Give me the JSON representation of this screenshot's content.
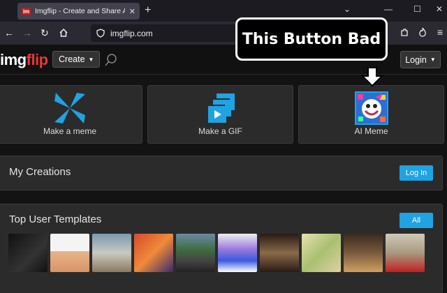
{
  "browser": {
    "tab_title": "Imgflip - Create and Share Awe",
    "favicon_text": "im",
    "url": "imgflip.com"
  },
  "site": {
    "logo_part1": "img",
    "logo_part2": "flip",
    "create_label": "Create",
    "login_label": "Login"
  },
  "cards": [
    {
      "label": "Make a meme",
      "icon": "pinwheel-icon"
    },
    {
      "label": "Make a GIF",
      "icon": "gif-stack-icon"
    },
    {
      "label": "AI Meme",
      "icon": "ai-face-icon"
    }
  ],
  "my_creations": {
    "title": "My Creations",
    "login_button": "Log In"
  },
  "templates": {
    "title": "Top User Templates",
    "all_button": "All",
    "thumbnail_count": 10
  },
  "annotation": {
    "text": "This Button Bad"
  },
  "colors": {
    "accent_blue": "#1fa3e2",
    "logo_red": "#e53935"
  }
}
